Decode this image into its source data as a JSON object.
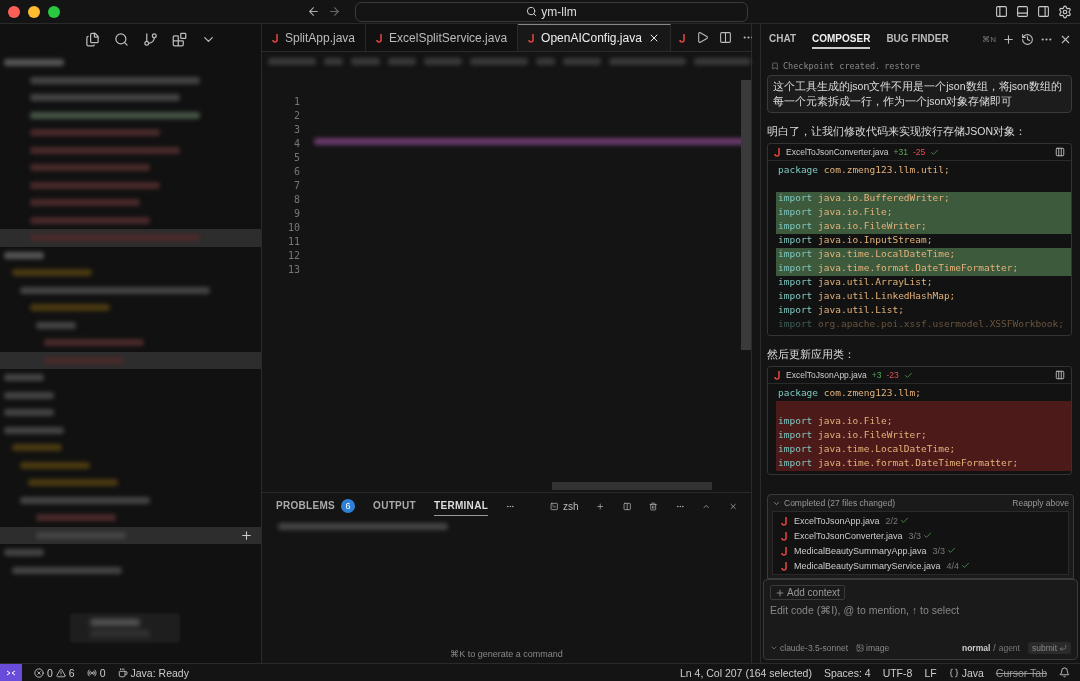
{
  "window": {
    "search": "ym-llm"
  },
  "editor_tabs": [
    {
      "label": "SplitApp.java",
      "selected": false
    },
    {
      "label": "ExcelSplitService.java",
      "selected": false
    },
    {
      "label": "OpenAIConfig.java",
      "selected": true
    }
  ],
  "line_numbers": [
    "1",
    "2",
    "3",
    "4",
    "5",
    "6",
    "7",
    "8",
    "9",
    "10",
    "11",
    "12",
    "13"
  ],
  "panel": {
    "tabs": [
      {
        "label": "PROBLEMS",
        "selected": false,
        "badge": "6"
      },
      {
        "label": "OUTPUT",
        "selected": false
      },
      {
        "label": "TERMINAL",
        "selected": true
      }
    ],
    "shell": "zsh",
    "hint": "⌘K to generate a command"
  },
  "chat": {
    "tabs": [
      {
        "label": "CHAT",
        "selected": false
      },
      {
        "label": "COMPOSER",
        "selected": true
      },
      {
        "label": "BUG FINDER",
        "selected": false
      }
    ],
    "shortcut": "⌘N",
    "checkpoint": "Checkpoint created.",
    "restore": "restore",
    "user_message": "这个工具生成的json文件不用是一个json数组，将json数组的每一个元素拆成一行，作为一个json对象存储即可",
    "messages": [
      {
        "text": "明白了，让我们修改代码来实现按行存储JSON对象：",
        "diff": {
          "file": "ExcelToJsonConverter.java",
          "added": "+31",
          "removed": "-25",
          "lines": [
            {
              "kind": "plain",
              "keyword": "package",
              "rest": "com.zmeng123.llm.util;"
            },
            {
              "kind": "plain"
            },
            {
              "kind": "added",
              "keyword": "import",
              "rest": "java.io.BufferedWriter;"
            },
            {
              "kind": "added",
              "keyword": "import",
              "rest": "java.io.File;"
            },
            {
              "kind": "added",
              "keyword": "import",
              "rest": "java.io.FileWriter;"
            },
            {
              "kind": "plain",
              "keyword": "import",
              "rest": "java.io.InputStream;"
            },
            {
              "kind": "added",
              "keyword": "import",
              "rest": "java.time.LocalDateTime;"
            },
            {
              "kind": "added",
              "keyword": "import",
              "rest": "java.time.format.DateTimeFormatter;"
            },
            {
              "kind": "plain",
              "keyword": "import",
              "rest": "java.util.ArrayList;"
            },
            {
              "kind": "plain",
              "keyword": "import",
              "rest": "java.util.LinkedHashMap;"
            },
            {
              "kind": "plain",
              "keyword": "import",
              "rest": "java.util.List;"
            },
            {
              "kind": "faded",
              "keyword": "import",
              "rest": "org.apache.poi.xssf.usermodel.XSSFWorkbook;"
            }
          ]
        }
      },
      {
        "text": "然后更新应用类：",
        "diff": {
          "file": "ExcelToJsonApp.java",
          "added": "+3",
          "removed": "-23",
          "lines": [
            {
              "kind": "plain",
              "keyword": "package",
              "rest": "com.zmeng123.llm;"
            },
            {
              "kind": "removed"
            },
            {
              "kind": "removed",
              "keyword": "import",
              "rest": "java.io.File;"
            },
            {
              "kind": "removed",
              "keyword": "import",
              "rest": "java.io.FileWriter;"
            },
            {
              "kind": "removed",
              "keyword": "import",
              "rest": "java.time.LocalDateTime;"
            },
            {
              "kind": "removed",
              "keyword": "import",
              "rest": "java.time.format.DateTimeFormatter;"
            }
          ]
        }
      }
    ],
    "completed": {
      "title": "Completed (27 files changed)",
      "action": "Reapply above",
      "files": [
        {
          "name": "ExcelToJsonApp.java",
          "count": "2/2"
        },
        {
          "name": "ExcelToJsonConverter.java",
          "count": "3/3"
        },
        {
          "name": "MedicalBeautySummaryApp.java",
          "count": "3/3"
        },
        {
          "name": "MedicalBeautySummaryService.java",
          "count": "4/4"
        }
      ]
    },
    "composer": {
      "add_context": "Add context",
      "placeholder": "Edit code (⌘I), @ to mention, ↑ to select",
      "model": "claude-3.5-sonnet",
      "image": "image",
      "modes": [
        {
          "label": "normal",
          "selected": true
        },
        {
          "label": "agent",
          "selected": false
        }
      ],
      "separator": "/",
      "submit": "submit"
    }
  },
  "status_bar": {
    "errors": "0",
    "warnings": "6",
    "ports": "0",
    "java": "Java: Ready",
    "position": "Ln 4, Col 207 (164 selected)",
    "spaces": "Spaces: 4",
    "encoding": "UTF-8",
    "eol": "LF",
    "language": "Java",
    "cursor_tab": "Cursor Tab"
  }
}
